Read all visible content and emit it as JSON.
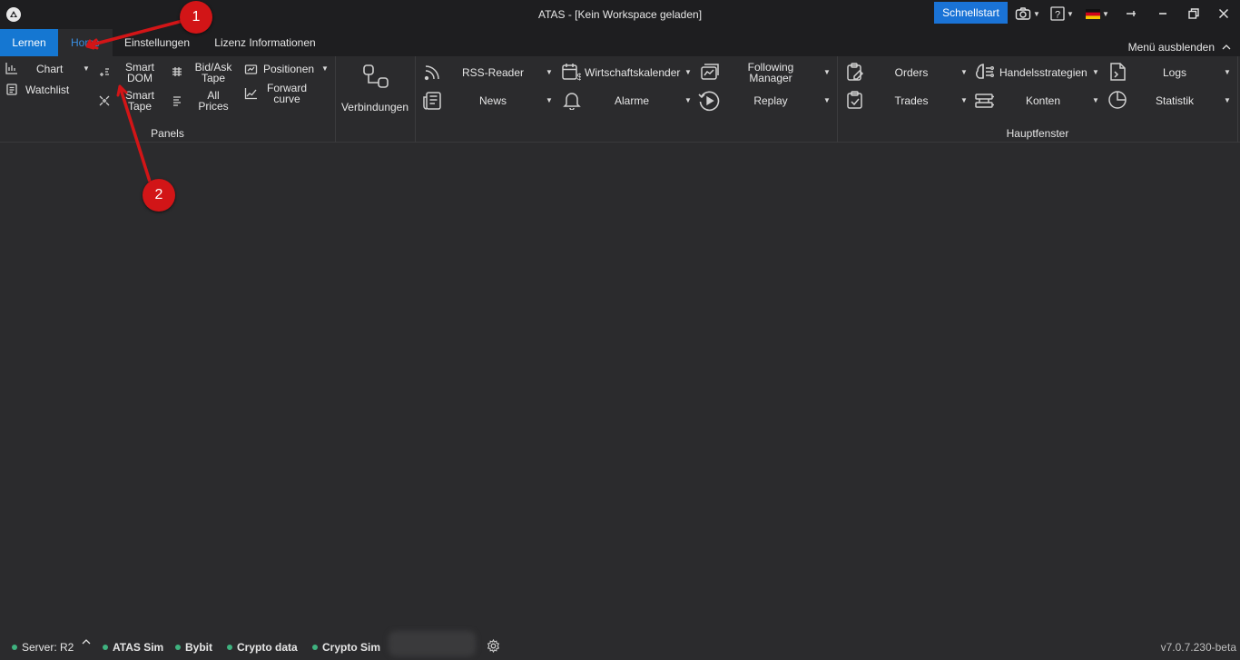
{
  "window": {
    "title": "ATAS - [Kein Workspace geladen]",
    "quickstart_label": "Schnellstart",
    "language_flag": "german-flag-icon"
  },
  "tabs": [
    {
      "label": "Lernen",
      "state": "accent"
    },
    {
      "label": "Home",
      "state": "selected"
    },
    {
      "label": "Einstellungen"
    },
    {
      "label": "Lizenz Informationen"
    }
  ],
  "hide_menu_label": "Menü ausblenden",
  "ribbon": {
    "panels": {
      "chart": "Chart",
      "watchlist": "Watchlist",
      "smart_dom": "Smart DOM",
      "smart_tape": "Smart Tape",
      "bid_ask_tape": "Bid/Ask Tape",
      "all_prices": "All Prices",
      "positionen": "Positionen",
      "forward_curve": "Forward curve",
      "group_label": "Panels"
    },
    "connections": {
      "label": "Verbindungen"
    },
    "main": {
      "rss_reader": "RSS-Reader",
      "news": "News",
      "wirtschaftskalender": "Wirtschaftskalender",
      "alarme": "Alarme",
      "following_manager": "Following Manager",
      "replay": "Replay",
      "orders": "Orders",
      "trades": "Trades",
      "handelsstrategien": "Handelsstrategien",
      "konten": "Konten",
      "logs": "Logs",
      "statistik": "Statistik",
      "group_label": "Hauptfenster"
    }
  },
  "status": {
    "server": "Server: R2",
    "items": [
      "ATAS Sim",
      "Bybit",
      "Crypto data",
      "Crypto Sim"
    ],
    "version": "v7.0.7.230-beta",
    "status_color": "#3fb27f"
  },
  "annotations": {
    "marker1": "1",
    "marker2": "2",
    "color": "#d21517"
  },
  "colors": {
    "accent": "#1577d2",
    "background": "#2b2b2d",
    "titlebar": "#1e1e20"
  }
}
